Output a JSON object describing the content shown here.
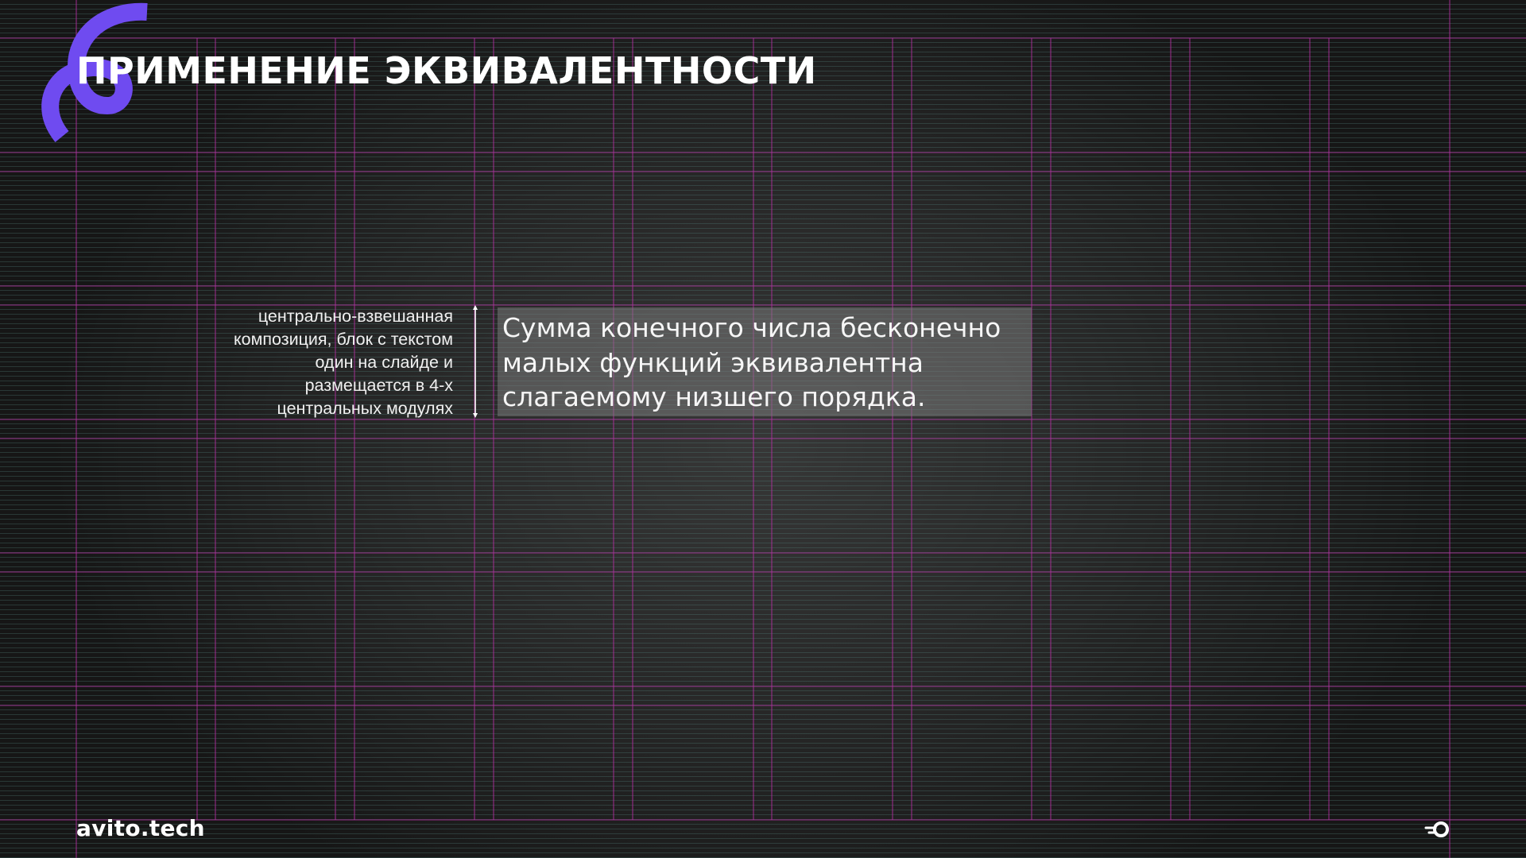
{
  "slide": {
    "title": "ПРИМЕНЕНИЕ ЭКВИВАЛЕНТНОСТИ",
    "annotation_lines": [
      "центрально-взвешанная",
      "композиция, блок с текстом",
      "один на слайде и",
      "размещается в 4-х",
      "центральных модулях"
    ],
    "main_text_lines": [
      "Сумма конечного числа бесконечно",
      "малых функций эквивалентна",
      "слагаемому низшего порядка."
    ],
    "brand": "avito.tech",
    "icons": {
      "logo_arc": "swirl-logo-icon",
      "brand_mark": "avito-mark-icon",
      "measure": "double-arrow-icon"
    }
  },
  "colors": {
    "background": "#262626",
    "accent_purple": "#6f4bf0",
    "grid_magenta": "#b0309e",
    "text": "#ffffff",
    "text_block_bg": "#7d7d7d"
  }
}
